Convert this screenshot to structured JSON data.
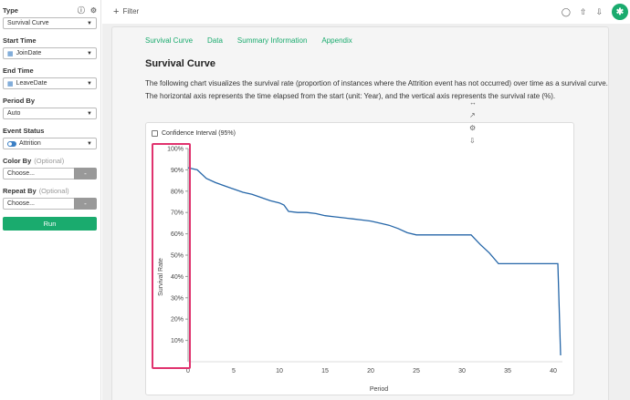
{
  "sidebar": {
    "type": {
      "label": "Type",
      "value": "Survival Curve"
    },
    "start_time": {
      "label": "Start Time",
      "value": "JoinDate"
    },
    "end_time": {
      "label": "End Time",
      "value": "LeaveDate"
    },
    "period_by": {
      "label": "Period By",
      "value": "Auto"
    },
    "event_status": {
      "label": "Event Status",
      "value": "Attrition"
    },
    "color_by": {
      "label": "Color By",
      "optional": "(Optional)",
      "placeholder": "Choose...",
      "minus": "-"
    },
    "repeat_by": {
      "label": "Repeat By",
      "optional": "(Optional)",
      "placeholder": "Choose...",
      "minus": "-"
    },
    "run": "Run",
    "icons": {
      "help": "help-icon",
      "settings": "gear-icon",
      "calendar": "calendar-icon",
      "toggle": "toggle-icon"
    }
  },
  "topbar": {
    "filter_label": "Filter",
    "icons": [
      "comment-icon",
      "share-icon",
      "download-icon"
    ],
    "avatar": "pin-avatar"
  },
  "main": {
    "tabs": [
      "Survival Curve",
      "Data",
      "Summary Information",
      "Appendix"
    ],
    "section_title": "Survival Curve",
    "description": "The following chart visualizes the survival rate (proportion of instances where the Attrition event has not occurred) over time as a survival curve. The horizontal axis represents the time elapsed from the start (unit: Year), and the vertical axis represents the survival rate (%).",
    "ci_label": "Confidence Interval (95%)",
    "tools": [
      "expand-icon",
      "resize-icon",
      "gear-icon",
      "download-icon"
    ]
  },
  "colors": {
    "accent": "#1aab6e",
    "line": "#2566a8",
    "highlight": "#e0326e"
  },
  "chart_data": {
    "type": "line",
    "xlabel": "Period",
    "ylabel": "Survival Rate",
    "xlim": [
      0,
      41
    ],
    "ylim": [
      0,
      100
    ],
    "x_ticks": [
      "0",
      "5",
      "10",
      "15",
      "20",
      "25",
      "30",
      "35",
      "40"
    ],
    "y_ticks": [
      "10%",
      "20%",
      "30%",
      "40%",
      "50%",
      "60%",
      "70%",
      "80%",
      "90%",
      "100%"
    ],
    "series": [
      {
        "x": [
          0,
          1,
          2,
          3,
          4,
          5,
          6,
          6.5,
          7,
          8,
          9,
          10,
          10.5,
          11,
          12,
          13,
          14,
          15,
          16,
          17,
          18,
          19,
          20,
          21,
          22,
          23,
          24,
          25,
          26,
          27,
          28,
          29,
          30,
          31,
          32,
          33,
          34,
          35,
          36,
          37,
          38,
          39,
          40,
          40.5,
          40.8
        ],
        "y": [
          91,
          90,
          86,
          84,
          82.5,
          81,
          79.5,
          79,
          78.5,
          77,
          75.5,
          74.5,
          73.5,
          70.5,
          70,
          70,
          69.5,
          68.5,
          68,
          67.5,
          67,
          66.5,
          66,
          65,
          64,
          62.5,
          60.5,
          59.5,
          59.5,
          59.5,
          59.5,
          59.5,
          59.5,
          59.5,
          55,
          51,
          46,
          46,
          46,
          46,
          46,
          46,
          46,
          46,
          3
        ]
      }
    ]
  }
}
